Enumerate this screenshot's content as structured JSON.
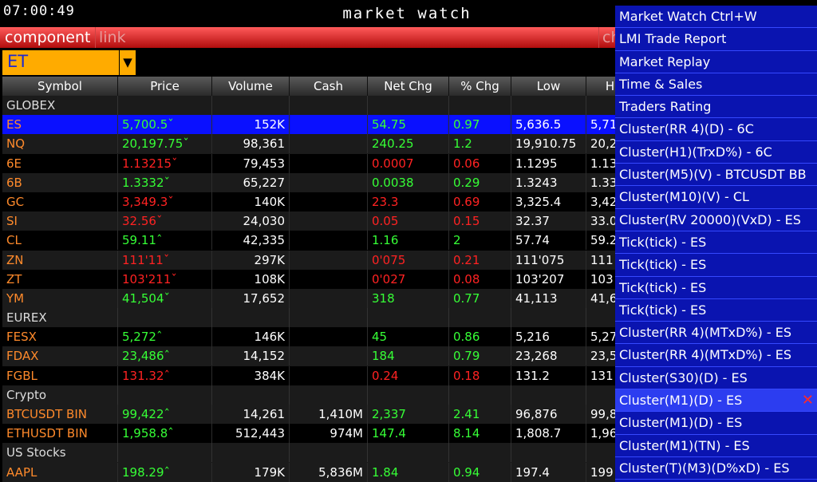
{
  "header": {
    "clock": "07:00:49",
    "title": "market watch"
  },
  "tabs": [
    "component",
    "link",
    "ch"
  ],
  "symbol_combo": {
    "value": "ET"
  },
  "columns": [
    "Symbol",
    "Price",
    "Volume",
    "Cash",
    "Net Chg",
    "% Chg",
    "Low",
    "H"
  ],
  "rows": [
    {
      "kind": "group",
      "symbol": "GLOBEX"
    },
    {
      "kind": "quote",
      "selected": true,
      "symbol": "ES",
      "price": "5,700.5ˇ",
      "volume": "152K",
      "cash": "",
      "net": "54.75",
      "pct": "0.97",
      "low": "5,636.5",
      "high": "5,71",
      "dir": "up"
    },
    {
      "kind": "quote",
      "symbol": "NQ",
      "price": "20,197.75ˇ",
      "volume": "98,361",
      "cash": "",
      "net": "240.25",
      "pct": "1.2",
      "low": "19,910.75",
      "high": "20,2",
      "dir": "up"
    },
    {
      "kind": "quote",
      "symbol": "6E",
      "price": "1.13215ˇ",
      "volume": "79,453",
      "cash": "",
      "net": "0.0007",
      "pct": "0.06",
      "low": "1.1295",
      "high": "1.13",
      "dir": "dn"
    },
    {
      "kind": "quote",
      "symbol": "6B",
      "price": "1.3332ˇ",
      "volume": "65,227",
      "cash": "",
      "net": "0.0038",
      "pct": "0.29",
      "low": "1.3243",
      "high": "1.33",
      "dir": "up"
    },
    {
      "kind": "quote",
      "symbol": "GC",
      "price": "3,349.3ˇ",
      "volume": "140K",
      "cash": "",
      "net": "23.3",
      "pct": "0.69",
      "low": "3,325.4",
      "high": "3,42",
      "dir": "dn"
    },
    {
      "kind": "quote",
      "symbol": "SI",
      "price": "32.56ˇ",
      "volume": "24,030",
      "cash": "",
      "net": "0.05",
      "pct": "0.15",
      "low": "32.37",
      "high": "33.0",
      "dir": "dn"
    },
    {
      "kind": "quote",
      "symbol": "CL",
      "price": "59.11ˆ",
      "volume": "42,335",
      "cash": "",
      "net": "1.16",
      "pct": "2",
      "low": "57.74",
      "high": "59.2",
      "dir": "up"
    },
    {
      "kind": "quote",
      "symbol": "ZN",
      "price": "111'11ˇ",
      "volume": "297K",
      "cash": "",
      "net": "0'075",
      "pct": "0.21",
      "low": "111'075",
      "high": "111",
      "dir": "dn"
    },
    {
      "kind": "quote",
      "symbol": "ZT",
      "price": "103'211ˇ",
      "volume": "108K",
      "cash": "",
      "net": "0'027",
      "pct": "0.08",
      "low": "103'207",
      "high": "103",
      "dir": "dn"
    },
    {
      "kind": "quote",
      "symbol": "YM",
      "price": "41,504ˇ",
      "volume": "17,652",
      "cash": "",
      "net": "318",
      "pct": "0.77",
      "low": "41,113",
      "high": "41,6",
      "dir": "up"
    },
    {
      "kind": "group",
      "symbol": "EUREX"
    },
    {
      "kind": "quote",
      "symbol": "FESX",
      "price": "5,272ˆ",
      "volume": "146K",
      "cash": "",
      "net": "45",
      "pct": "0.86",
      "low": "5,216",
      "high": "5,27",
      "dir": "up"
    },
    {
      "kind": "quote",
      "symbol": "FDAX",
      "price": "23,486ˆ",
      "volume": "14,152",
      "cash": "",
      "net": "184",
      "pct": "0.79",
      "low": "23,268",
      "high": "23,5",
      "dir": "up"
    },
    {
      "kind": "quote",
      "symbol": "FGBL",
      "price": "131.32ˆ",
      "volume": "384K",
      "cash": "",
      "net": "0.24",
      "pct": "0.18",
      "low": "131.2",
      "high": "131",
      "dir": "dn"
    },
    {
      "kind": "group",
      "symbol": "Crypto"
    },
    {
      "kind": "quote",
      "symbol": "BTCUSDT BIN",
      "price": "99,422ˆ",
      "volume": "14,261",
      "cash": "1,410M",
      "net": "2,337",
      "pct": "2.41",
      "low": "96,876",
      "high": "99,8",
      "dir": "up"
    },
    {
      "kind": "quote",
      "symbol": "ETHUSDT BIN",
      "price": "1,958.8ˆ",
      "volume": "512,443",
      "cash": "974M",
      "net": "147.4",
      "pct": "8.14",
      "low": "1,808.7",
      "high": "1,96",
      "dir": "up"
    },
    {
      "kind": "group",
      "symbol": "US Stocks"
    },
    {
      "kind": "quote",
      "symbol": "AAPL",
      "price": "198.29ˆ",
      "volume": "179K",
      "cash": "5,836M",
      "net": "1.84",
      "pct": "0.94",
      "low": "197.4",
      "high": "199",
      "dir": "up"
    }
  ],
  "menu": {
    "items": [
      "Market Watch  Ctrl+W",
      "LMI Trade Report",
      "Market Replay",
      "Time & Sales",
      "Traders Rating",
      "Cluster(RR 4)(D) - 6C",
      "Cluster(H1)(TrxD%) - 6C",
      "Cluster(M5)(V) - BTCUSDT BB",
      "Cluster(M10)(V) - CL",
      "Cluster(RV 20000)(VxD) - ES",
      "Tick(tick) - ES",
      "Tick(tick) - ES",
      "Tick(tick) - ES",
      "Tick(tick) - ES",
      "Cluster(RR 4)(MTxD%) - ES",
      "Cluster(RR 4)(MTxD%) - ES",
      "Cluster(S30)(D) - ES",
      "Cluster(M1)(D) - ES",
      "Cluster(M1)(D) - ES",
      "Cluster(M1)(TN) - ES",
      "Cluster(T)(M3)(D%xD) - ES"
    ],
    "selected_index": 17,
    "close_glyph": "✕"
  },
  "colors": {
    "up": "#36ff36",
    "down": "#ff2222",
    "symbol": "#ff8a2b",
    "selected_row": "#0a10ff",
    "menu_bg": "#0a14b0",
    "tab_bar": "#d21a1a",
    "combo": "#ffab00"
  }
}
